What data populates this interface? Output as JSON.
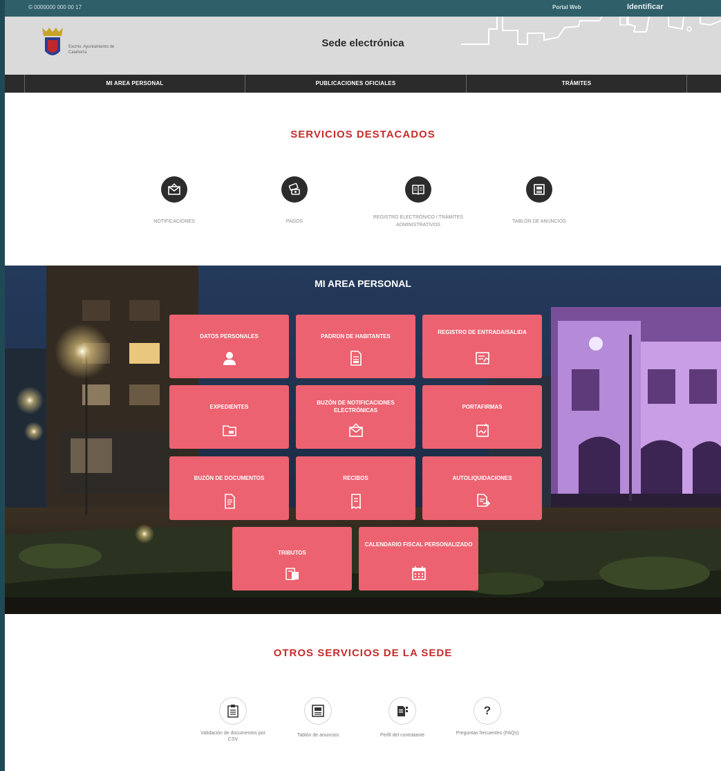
{
  "topbar": {
    "phone": "© 0000000 000 00 17",
    "portal_link": "Portal Web",
    "login": "Identificar"
  },
  "header": {
    "title": "Sede electrónica",
    "org_name": "Excmo. Ayuntamiento de Calahorra"
  },
  "nav": {
    "items": [
      "MI AREA PERSONAL",
      "PUBLICACIONES OFICIALES",
      "TRÁMITES"
    ]
  },
  "featured": {
    "title": "SERVICIOS DESTACADOS",
    "items": [
      {
        "label": "NOTIFICACIONES",
        "icon": "envelope-icon"
      },
      {
        "label": "PAGOS",
        "icon": "payment-icon"
      },
      {
        "label": "REGISTRO ELECTRÓNICO / TRÁMITES ADMINISTRATIVOS",
        "icon": "book-icon"
      },
      {
        "label": "TABLÓN DE ANUNCIOS",
        "icon": "board-icon"
      }
    ]
  },
  "area": {
    "title": "MI AREA PERSONAL",
    "tiles": [
      {
        "label": "DATOS PERSONALES",
        "icon": "person-icon"
      },
      {
        "label": "PADRON DE HABITANTES",
        "icon": "document-icon"
      },
      {
        "label": "REGISTRO DE ENTRADA/SALIDA",
        "icon": "register-icon"
      },
      {
        "label": "EXPEDIENTES",
        "icon": "folder-icon"
      },
      {
        "label": "BUZÓN DE NOTIFICACIONES ELECTRÓNICAS",
        "icon": "mail-icon"
      },
      {
        "label": "PORTAFIRMAS",
        "icon": "signature-icon"
      },
      {
        "label": "BUZÓN DE DOCUMENTOS",
        "icon": "docs-icon"
      },
      {
        "label": "RECIBOS",
        "icon": "receipt-icon"
      },
      {
        "label": "AUTOLIQUIDACIONES",
        "icon": "self-assessment-icon"
      },
      {
        "label": "TRIBUTOS",
        "icon": "taxes-icon"
      },
      {
        "label": "CALENDARIO FISCAL PERSONALIZADO",
        "icon": "calendar-icon"
      }
    ]
  },
  "other": {
    "title": "OTROS SERVICIOS DE LA SEDE",
    "items": [
      {
        "label": "Validación de documentos por CSV",
        "icon": "clipboard-icon"
      },
      {
        "label": "Tablón de anuncios",
        "icon": "board-icon"
      },
      {
        "label": "Perfil del contratante",
        "icon": "profile-doc-icon"
      },
      {
        "label": "Preguntas frecuentes (FAQs)",
        "icon": "question-icon"
      }
    ]
  },
  "colors": {
    "accent": "#c62b2b",
    "tile": "#ec6270",
    "nav": "#2b2b2b",
    "header": "#dadada"
  }
}
